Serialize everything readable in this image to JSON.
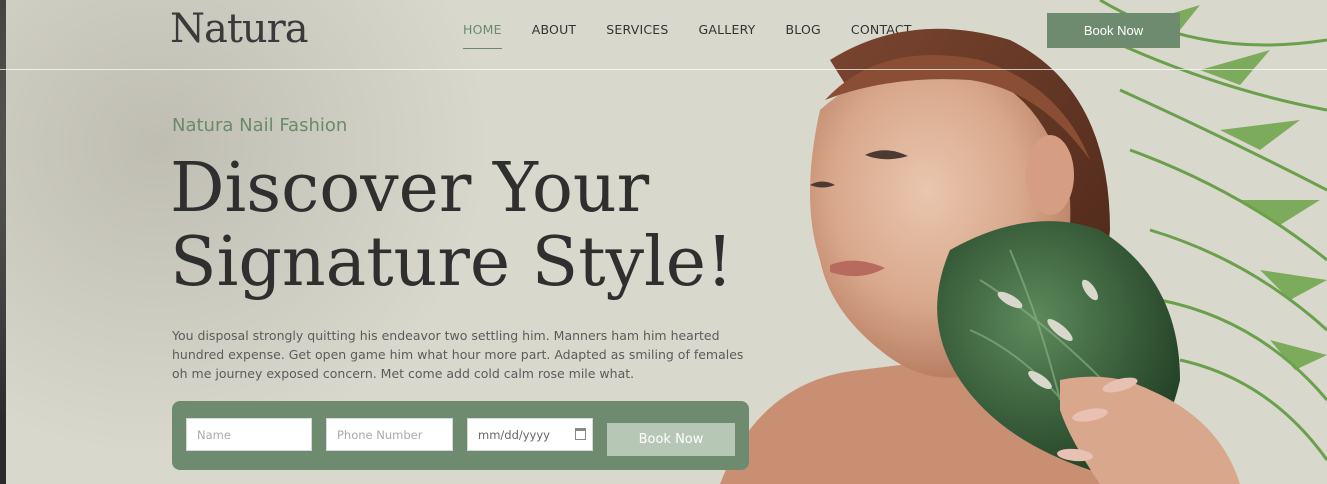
{
  "brand": {
    "logo": "Natura"
  },
  "nav": {
    "items": [
      {
        "label": "HOME",
        "active": true
      },
      {
        "label": "ABOUT",
        "active": false
      },
      {
        "label": "SERVICES",
        "active": false
      },
      {
        "label": "GALLERY",
        "active": false
      },
      {
        "label": "BLOG",
        "active": false
      },
      {
        "label": "CONTACT",
        "active": false
      }
    ],
    "book_label": "Book Now"
  },
  "hero": {
    "subtitle": "Natura Nail Fashion",
    "headline_line1": "Discover Your",
    "headline_line2": "Signature Style!",
    "description": "You disposal strongly quitting his endeavor two settling him. Manners ham him hearted hundred expense. Get open game him what hour more part. Adapted as smiling of females oh me journey exposed concern. Met come add cold calm rose mile what."
  },
  "form": {
    "name_placeholder": "Name",
    "phone_placeholder": "Phone Number",
    "date_placeholder": "mm/dd/yyyy",
    "submit_label": "Book Now"
  },
  "colors": {
    "accent": "#6f8b6f",
    "background": "#d9d8cd",
    "button_light": "#b6c8b5"
  },
  "icons": [
    "calendar-icon"
  ]
}
